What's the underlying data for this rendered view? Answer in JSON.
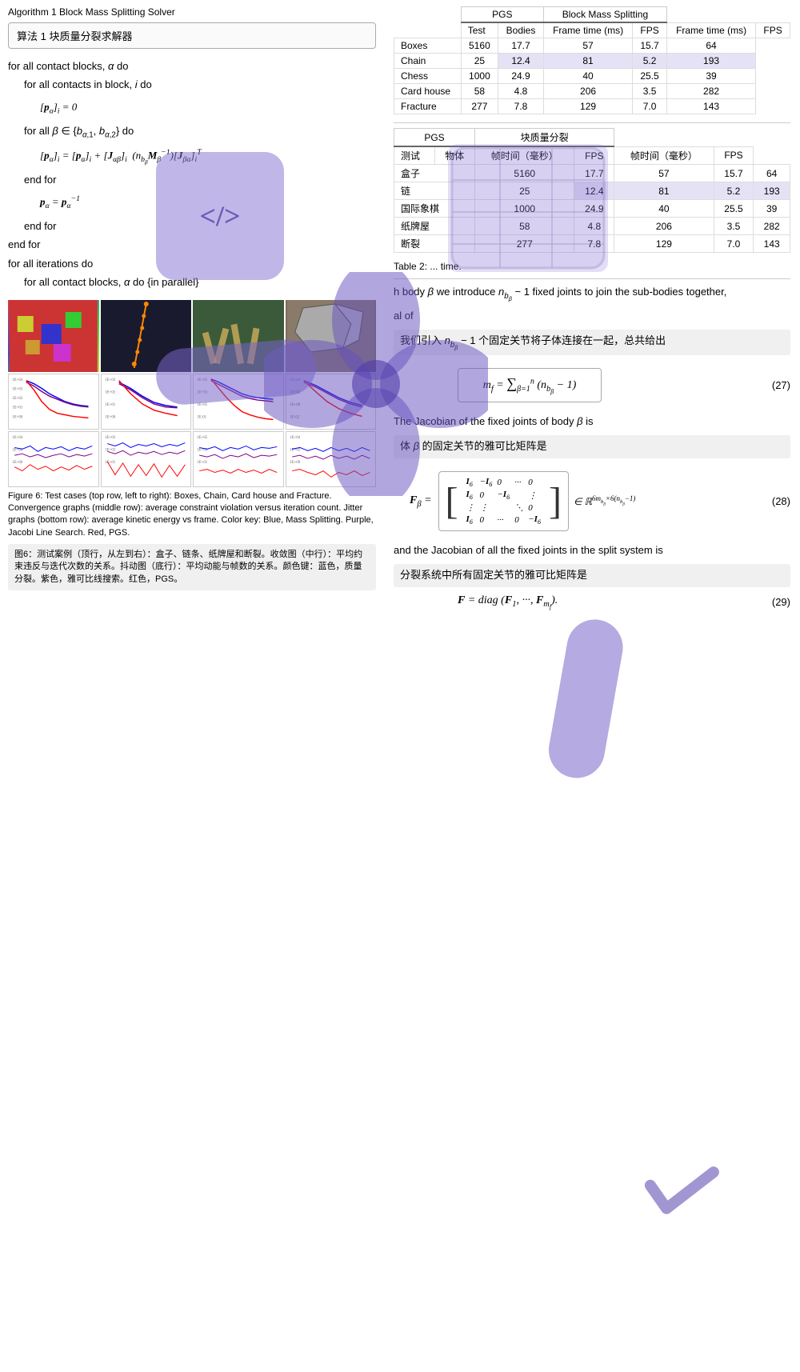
{
  "left": {
    "algo_title": "Algorithm 1 Block Mass Splitting Solver",
    "algo_box_label": "算法 1 块质量分裂求解器",
    "algo_lines": [
      {
        "text": "for all contact blocks, α do",
        "indent": 0
      },
      {
        "text": "for all contacts in block, i do",
        "indent": 1
      },
      {
        "text": "[p",
        "indent": 2
      },
      {
        "text": "for all β ∈ {b",
        "indent": 2
      },
      {
        "text": "[p",
        "indent": 3
      },
      {
        "text": "end for",
        "indent": 2
      },
      {
        "text": "p",
        "indent": 2
      },
      {
        "text": "end for",
        "indent": 1
      },
      {
        "text": "end for",
        "indent": 0
      },
      {
        "text": "for all iterations do",
        "indent": 0
      },
      {
        "text": "for all contact blocks, α do {in parallel}",
        "indent": 1
      }
    ],
    "figure_caption": "Figure 6: Test cases (top row, left to right): Boxes, Chain, Card house and Fracture. Convergence graphs (middle row): average constraint violation versus iteration count. Jitter graphs (bottom row): average kinetic energy vs frame. Color key: Blue, Mass Splitting. Purple, Jacobi Line Search. Red, PGS.",
    "figure_caption_cn": "图6：测试案例（顶行，从左到右）：盒子、链条、纸牌屋和断裂。收敛图（中行）：平均约束违反与迭代次数的关系。抖动图（底行）：平均动能与帧数的关系。颜色键：蓝色，质量分裂。紫色，雅可比线搜索。红色，PGS。"
  },
  "right": {
    "table1": {
      "headers": [
        "Test",
        "Bodies",
        "PGS",
        "",
        "Block Mass Splitting",
        ""
      ],
      "subheaders": [
        "",
        "",
        "Frame time (ms)",
        "FPS",
        "Frame time (ms)",
        "FPS"
      ],
      "rows": [
        [
          "Boxes",
          "5160",
          "17.7",
          "57",
          "15.7",
          "64"
        ],
        [
          "Chain",
          "25",
          "12.4",
          "81",
          "5.2",
          "193"
        ],
        [
          "Chess",
          "1000",
          "24.9",
          "40",
          "25.5",
          "39"
        ],
        [
          "Card house",
          "58",
          "4.8",
          "206",
          "3.5",
          "282"
        ],
        [
          "Fracture",
          "277",
          "7.8",
          "129",
          "7.0",
          "143"
        ]
      ]
    },
    "table2": {
      "headers": [
        "测试",
        "物体",
        "PGS",
        "",
        "块质量分裂",
        ""
      ],
      "subheaders": [
        "",
        "",
        "帧时间（毫秒）",
        "FPS",
        "帧时间（毫秒）",
        "FPS"
      ],
      "rows": [
        [
          "盒子",
          "5160",
          "17.7",
          "57",
          "15.7",
          "64"
        ],
        [
          "链",
          "25",
          "12.4",
          "81",
          "5.2",
          "193"
        ],
        [
          "国际象棋",
          "1000",
          "24.9",
          "40",
          "25.5",
          "39"
        ],
        [
          "纸牌屋",
          "58",
          "4.8",
          "206",
          "3.5",
          "282"
        ],
        [
          "断裂",
          "277",
          "7.8",
          "129",
          "7.0",
          "143"
        ]
      ]
    },
    "table_caption": "Table 2: ... time.",
    "text1": "h body β we introduce n",
    "text1b": "− 1 fixed joints to join the sub-bodies together,",
    "text2": "al of",
    "text_cn1": "我们引入 n",
    "text_cn1b": "− 1 个固定关节将子体连接在一起，总共给出",
    "eq27_lhs": "m",
    "eq27_rhs": "Σ (n",
    "eq27_num": "(27)",
    "text3": "The Jacobian of the fixed joints of body β is",
    "text_cn2": "体 β 的固定关节的雅可比矩阵是",
    "eq28_num": "(28)",
    "text4": "and the Jacobian of all the fixed joints in the split system is",
    "text_cn3": "分裂系统中所有固定关节的雅可比矩阵是",
    "eq29": "F = diag (F₁, ···, F",
    "eq29_num": "(29)"
  },
  "watermark": {
    "visible": true
  }
}
